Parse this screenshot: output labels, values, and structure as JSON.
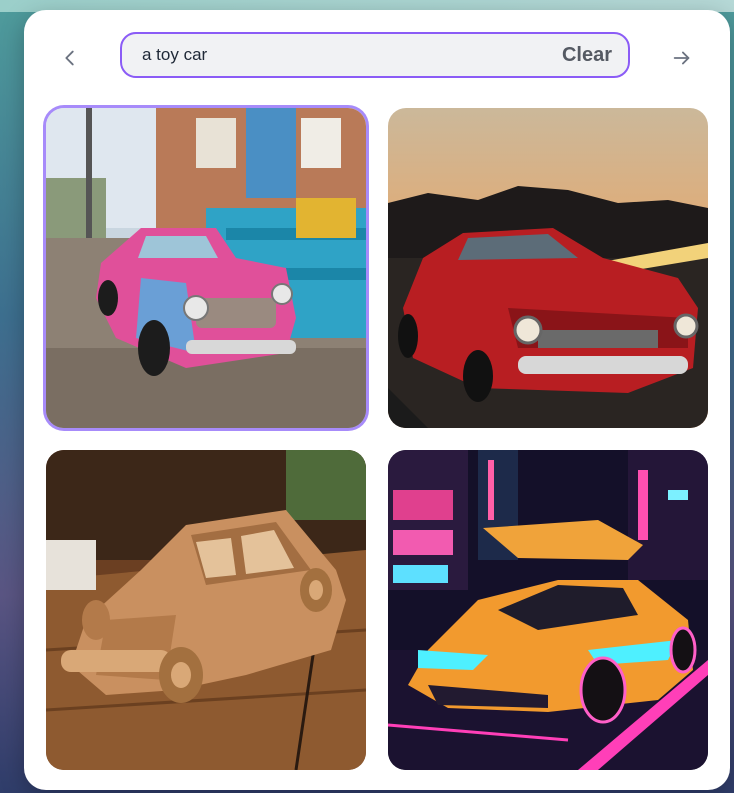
{
  "search": {
    "query": "a toy car",
    "clear_label": "Clear"
  },
  "icons": {
    "back": "chevron-left-icon",
    "forward": "arrow-right-icon"
  },
  "images": [
    {
      "subject": "pink-blue-toy-car-on-street",
      "selected": true
    },
    {
      "subject": "red-classic-car-sunset",
      "selected": false
    },
    {
      "subject": "carved-wooden-toy-car",
      "selected": false
    },
    {
      "subject": "orange-neon-sports-car",
      "selected": false
    }
  ],
  "colors": {
    "accent": "#8b5cf6",
    "selection_ring": "#a78bfa"
  }
}
